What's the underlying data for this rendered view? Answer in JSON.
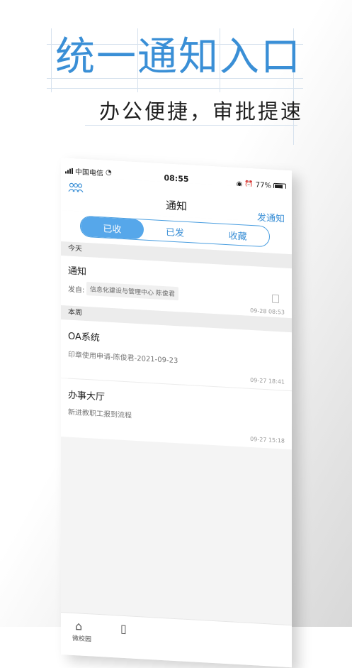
{
  "hero": {
    "title": "统一通知入口",
    "subtitle": "办公便捷，审批提速"
  },
  "status_bar": {
    "carrier": "中国电信",
    "time": "08:55",
    "battery": "77%"
  },
  "nav": {
    "title": "通知",
    "action": "发通知",
    "left_icon": "contacts-icon"
  },
  "tabs": [
    {
      "label": "已收",
      "active": true
    },
    {
      "label": "已发",
      "active": false
    },
    {
      "label": "收藏",
      "active": false
    }
  ],
  "sections": {
    "today": "今天",
    "this_week": "本周"
  },
  "items": [
    {
      "title": "通知",
      "from_label": "发自:",
      "from": "信息化建设与管理中心 陈俊君",
      "time": "09-28 08:53"
    },
    {
      "title": "OA系统",
      "subtitle": "印章使用申请-陈俊君-2021-09-23",
      "time": "09-27 18:41"
    },
    {
      "title": "办事大厅",
      "subtitle": "新进教职工报到流程",
      "time": "09-27 15:18"
    }
  ],
  "tabbar": {
    "items": [
      {
        "icon": "home-icon",
        "label": "微校园"
      },
      {
        "icon": "clipboard-icon",
        "label": ""
      }
    ]
  },
  "colors": {
    "accent": "#3a8fd6",
    "segment_active": "#56a7ea"
  }
}
